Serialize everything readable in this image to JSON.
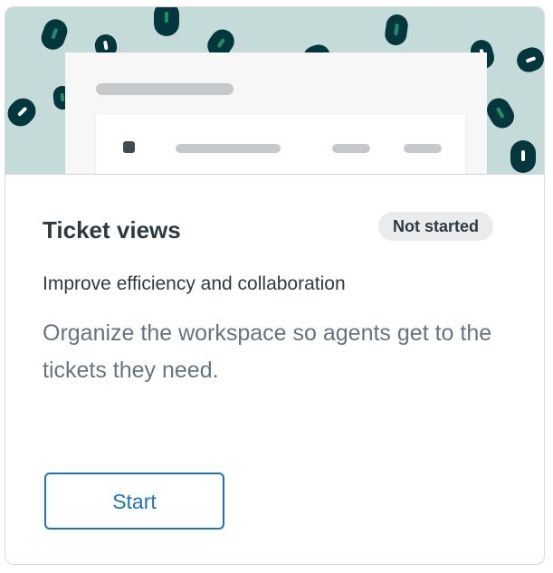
{
  "card": {
    "title": "Ticket views",
    "status_badge": "Not started",
    "subtitle": "Improve efficiency and collaboration",
    "description": "Organize the workspace so agents get to the tickets they need.",
    "start_label": "Start"
  },
  "colors": {
    "hero_background": "#c5dbda",
    "blob_dark": "#03363d",
    "blob_accent": "#228f67",
    "title_text": "#2f3941",
    "description_text": "#68737d",
    "badge_background": "#e9ebed",
    "button_accent": "#1f73b7"
  }
}
